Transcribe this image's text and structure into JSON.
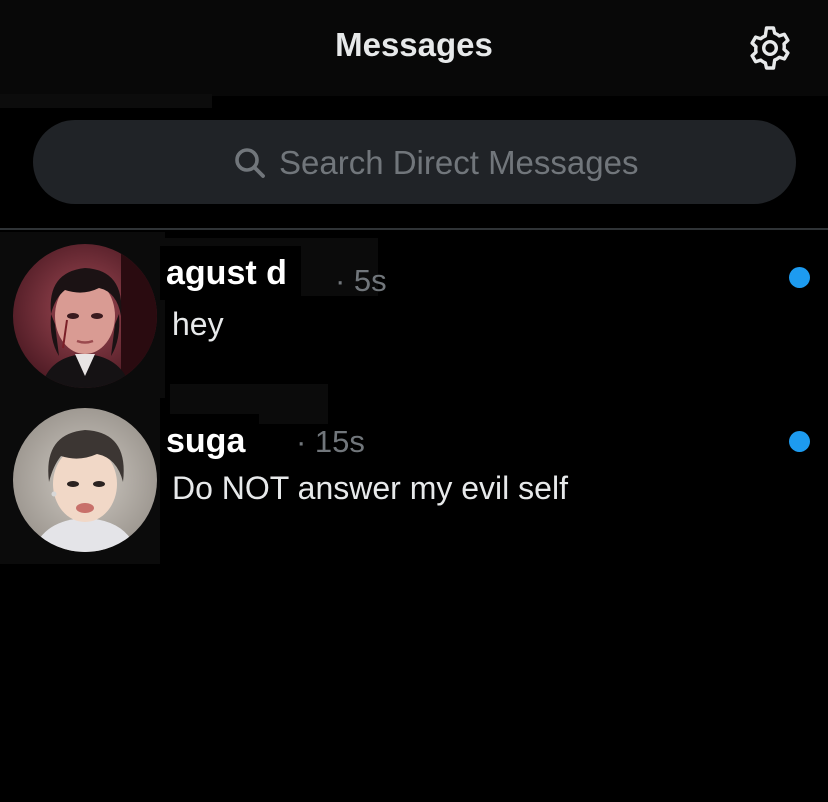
{
  "header": {
    "title": "Messages",
    "settings_icon": "gear-icon"
  },
  "search": {
    "icon": "search-icon",
    "placeholder": "Search Direct Messages"
  },
  "conversations": [
    {
      "name": "agust d",
      "time": "· 5s",
      "preview": "hey",
      "unread": true
    },
    {
      "name": "suga",
      "time": "· 15s",
      "preview": "Do NOT answer my evil self",
      "unread": true
    }
  ],
  "colors": {
    "background": "#000000",
    "search_bg": "#202327",
    "secondary_text": "#71767b",
    "unread_dot": "#1d9bf0"
  }
}
